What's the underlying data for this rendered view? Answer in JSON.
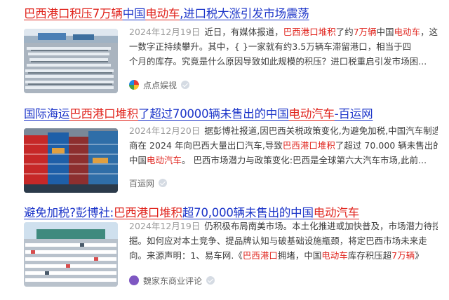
{
  "results": [
    {
      "title_parts": [
        {
          "t": "巴西港口积压7万辆",
          "c": "r"
        },
        {
          "t": "中国",
          "c": "b"
        },
        {
          "t": "电动车",
          "c": "r"
        },
        {
          "t": ",进口税大涨引发市场震荡",
          "c": "b"
        }
      ],
      "date": "2024年12月19日",
      "snippet_lines": [
        [
          {
            "t": "近日，有媒体报道，"
          },
          {
            "t": "巴西港口堆积",
            "h": true
          },
          {
            "t": "了约"
          },
          {
            "t": "7万辆",
            "h": true
          },
          {
            "t": "中国"
          },
          {
            "t": "电动车",
            "h": true
          },
          {
            "t": "，这"
          }
        ],
        [
          {
            "t": "一数字正持续攀升。其中，{          }一家就有约3.5万辆车滞留港口，相当于四"
          }
        ],
        [
          {
            "t": "个月的库存。究竟是什么原因导致如此规模的积压？进口税重启引发市场困..."
          }
        ]
      ],
      "source": "点点娱视",
      "source_color": "#e53935"
    },
    {
      "title_parts": [
        {
          "t": "国际海运",
          "c": "b"
        },
        {
          "t": "巴西港口堆积",
          "c": "r"
        },
        {
          "t": "了超过70000辆未售出的中国",
          "c": "b"
        },
        {
          "t": "电动汽车",
          "c": "r"
        },
        {
          "t": "-百运网",
          "c": "b"
        }
      ],
      "date": "2024年12月20日",
      "snippet_lines": [
        [
          {
            "t": "据彭博社报道,因巴西关税政策变化,为避免加税,中国汽车制造"
          }
        ],
        [
          {
            "t": "商在 2024 年向巴西大量出口汽车,导致"
          },
          {
            "t": "巴西港口堆积",
            "h": true
          },
          {
            "t": "了超过 70.000 辆未售出的"
          }
        ],
        [
          {
            "t": "中国"
          },
          {
            "t": "电动汽车",
            "h": true
          },
          {
            "t": "。 巴西市场潜力与政策变化:巴西是全球第六大汽车市场,此前..."
          }
        ]
      ],
      "source": "百运网",
      "source_color": ""
    },
    {
      "title_parts": [
        {
          "t": "避免加税?彭博社:",
          "c": "b"
        },
        {
          "t": "巴西港口堆积",
          "c": "r"
        },
        {
          "t": "超70,000辆未售出的中国",
          "c": "b"
        },
        {
          "t": "电动汽车",
          "c": "r"
        }
      ],
      "date": "2024年12月19日",
      "snippet_lines": [
        [
          {
            "t": "仍积极布局南美市场。本土化推进或加快普及，市场潜力待挖"
          }
        ],
        [
          {
            "t": "掘。如何应对本土竞争、提品牌认知与破基础设施瓶颈，将定巴西市场未来走"
          }
        ],
        [
          {
            "t": "向。来源声明：1、易车网.《"
          },
          {
            "t": "巴西港口",
            "h": true
          },
          {
            "t": "拥堵，中国"
          },
          {
            "t": "电动车",
            "h": true
          },
          {
            "t": "库存积压超"
          },
          {
            "t": "7万辆",
            "h": true
          },
          {
            "t": "》"
          }
        ]
      ],
      "source": "魏家东商业评论",
      "source_color": "#7e57c2"
    }
  ],
  "colors": {
    "link": "#1c35c9",
    "highlight": "#e0241d",
    "date": "#9a9a9a"
  }
}
